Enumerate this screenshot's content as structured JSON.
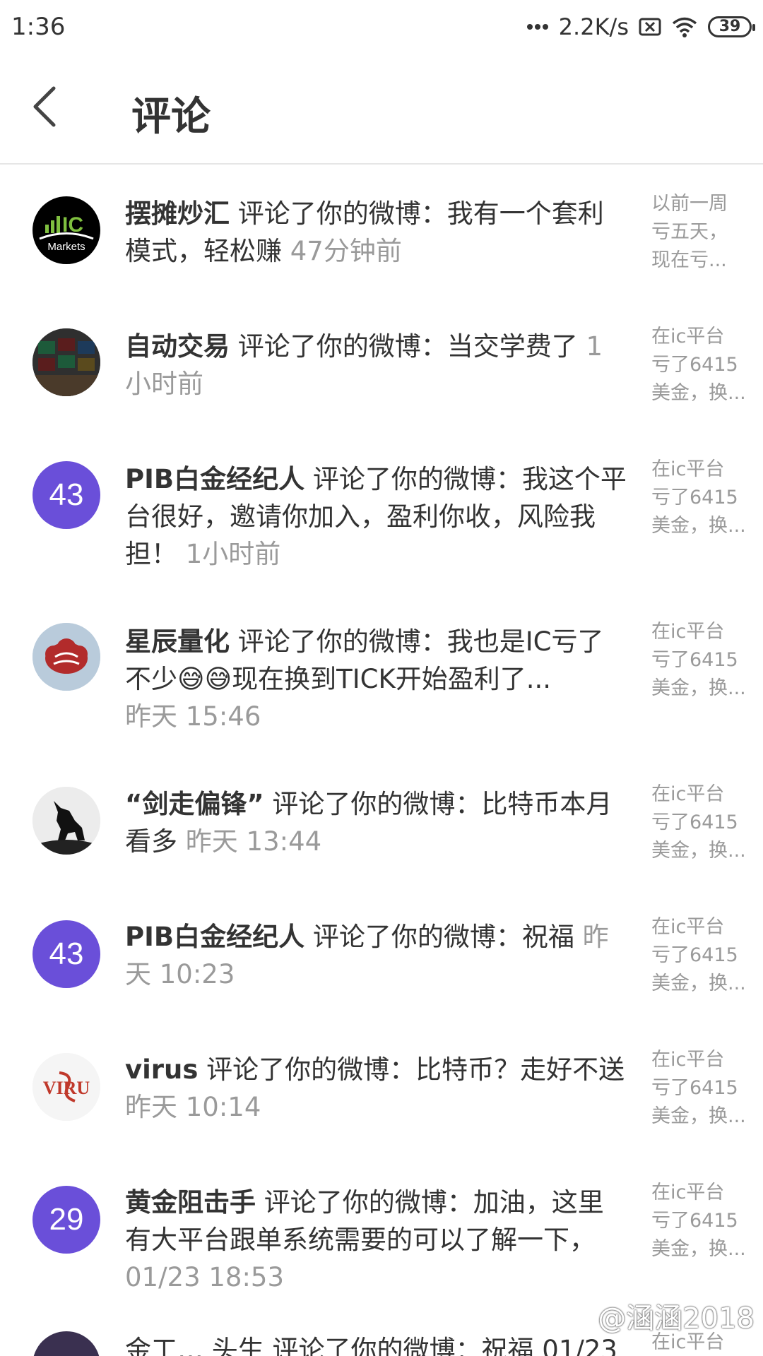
{
  "status_bar": {
    "time": "1:36",
    "network_speed": "2.2K/s",
    "battery": "39",
    "icons": [
      "signal-dots-icon",
      "no-sim-icon",
      "wifi-icon",
      "battery-icon"
    ]
  },
  "header": {
    "title": "评论",
    "back_icon": "chevron-left-icon"
  },
  "items": [
    {
      "name": "摆摊炒汇",
      "text": " 评论了你的微博：我有一个套利模式，轻松赚 ",
      "time": "47分钟前",
      "avatar_type": "image",
      "avatar_text": "IC Markets",
      "preview": [
        "以前一周",
        "亏五天，",
        "现在亏..."
      ]
    },
    {
      "name": "自动交易",
      "text": " 评论了你的微博：当交学费了 ",
      "time": "1小时前",
      "avatar_type": "image",
      "avatar_text": "",
      "preview": [
        "在ic平台",
        "亏了6415",
        "美金，换..."
      ]
    },
    {
      "name": "PIB白金经纪人",
      "text": " 评论了你的微博：我这个平台很好，邀请你加入，盈利你收，风险我担！ ",
      "time": "1小时前",
      "avatar_type": "number",
      "avatar_text": "43",
      "preview": [
        "在ic平台",
        "亏了6415",
        "美金，换..."
      ]
    },
    {
      "name": "星辰量化",
      "text": " 评论了你的微博：我也是IC亏了不少😅😅现在换到TICK开始盈利了...",
      "time": "昨天 15:46",
      "avatar_type": "image",
      "avatar_text": "",
      "preview": [
        "在ic平台",
        "亏了6415",
        "美金，换..."
      ]
    },
    {
      "name": "“剑走偏锋”",
      "text": " 评论了你的微博：比特币本月看多 ",
      "time": "昨天 13:44",
      "avatar_type": "image",
      "avatar_text": "",
      "preview": [
        "在ic平台",
        "亏了6415",
        "美金，换..."
      ]
    },
    {
      "name": "PIB白金经纪人",
      "text": " 评论了你的微博：祝福 ",
      "time": "昨天 10:23",
      "avatar_type": "number",
      "avatar_text": "43",
      "preview": [
        "在ic平台",
        "亏了6415",
        "美金，换..."
      ]
    },
    {
      "name": "virus",
      "text": " 评论了你的微博：比特币？走好不送 ",
      "time": "昨天 10:14",
      "avatar_type": "image",
      "avatar_text": "VIRUS",
      "preview": [
        "在ic平台",
        "亏了6415",
        "美金，换..."
      ]
    },
    {
      "name": "黄金阻击手",
      "text": " 评论了你的微博：加油，这里有大平台跟单系统需要的可以了解一下，",
      "time": "01/23 18:53",
      "avatar_type": "number",
      "avatar_text": "29",
      "preview": [
        "在ic平台",
        "亏了6415",
        "美金，换..."
      ]
    }
  ],
  "partial_item": {
    "text": "金工… 头生 评论了你的微博：祝福 01/23",
    "preview": "在ic平台"
  },
  "watermark": "@涵涵2018",
  "colors": {
    "avatar_purple": "#6a4fd9",
    "time_gray": "#9a9a9a",
    "text_dark": "#333333",
    "divider": "#e6e6e6"
  }
}
